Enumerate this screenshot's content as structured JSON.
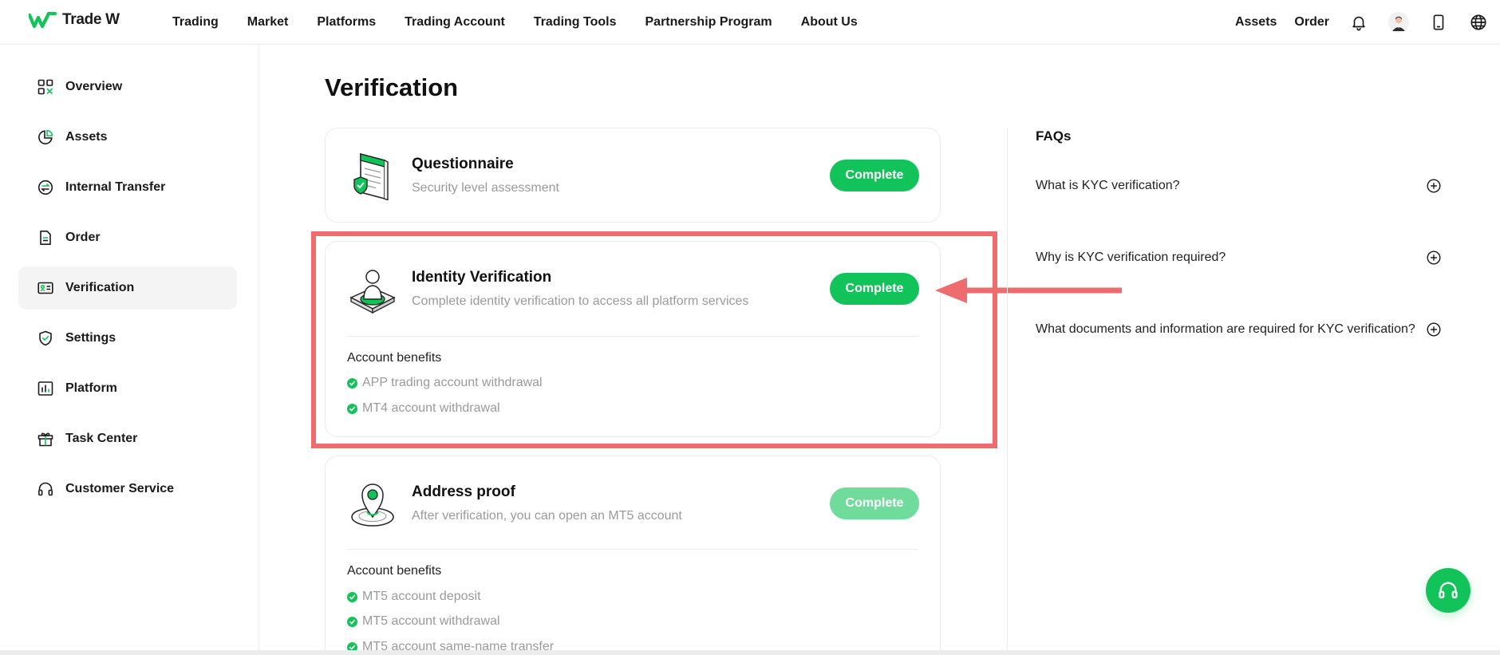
{
  "brand": {
    "logo_text": "Trade W",
    "accent": "#12c35a",
    "highlight": "#ee6b6e"
  },
  "nav": {
    "items": [
      "Trading",
      "Market",
      "Platforms",
      "Trading Account",
      "Trading Tools",
      "Partnership Program",
      "About Us"
    ]
  },
  "top_right": {
    "assets": "Assets",
    "order": "Order",
    "icons": [
      "bell-icon",
      "avatar",
      "phone-icon",
      "globe-icon"
    ]
  },
  "sidebar": {
    "items": [
      {
        "label": "Overview",
        "icon": "grid-icon"
      },
      {
        "label": "Assets",
        "icon": "pie-chart-icon"
      },
      {
        "label": "Internal Transfer",
        "icon": "transfer-icon"
      },
      {
        "label": "Order",
        "icon": "document-icon"
      },
      {
        "label": "Verification",
        "icon": "id-card-icon",
        "active": true
      },
      {
        "label": "Settings",
        "icon": "shield-icon"
      },
      {
        "label": "Platform",
        "icon": "bar-chart-icon"
      },
      {
        "label": "Task Center",
        "icon": "gift-icon"
      },
      {
        "label": "Customer Service",
        "icon": "headset-icon"
      }
    ]
  },
  "main": {
    "title": "Verification",
    "cards": [
      {
        "title": "Questionnaire",
        "subtitle": "Security level assessment",
        "button": "Complete"
      },
      {
        "title": "Identity Verification",
        "subtitle": "Complete identity verification to access all platform services",
        "button": "Complete",
        "benefits_title": "Account benefits",
        "benefits": [
          "APP trading account withdrawal",
          "MT4 account withdrawal"
        ]
      },
      {
        "title": "Address proof",
        "subtitle": "After verification, you can open an MT5 account",
        "button": "Complete",
        "benefits_title": "Account benefits",
        "benefits": [
          "MT5 account deposit",
          "MT5 account withdrawal",
          "MT5 account same-name transfer"
        ]
      }
    ]
  },
  "faq": {
    "title": "FAQs",
    "items": [
      "What is KYC verification?",
      "Why is KYC verification required?",
      "What documents and information are required for KYC verification?"
    ]
  }
}
